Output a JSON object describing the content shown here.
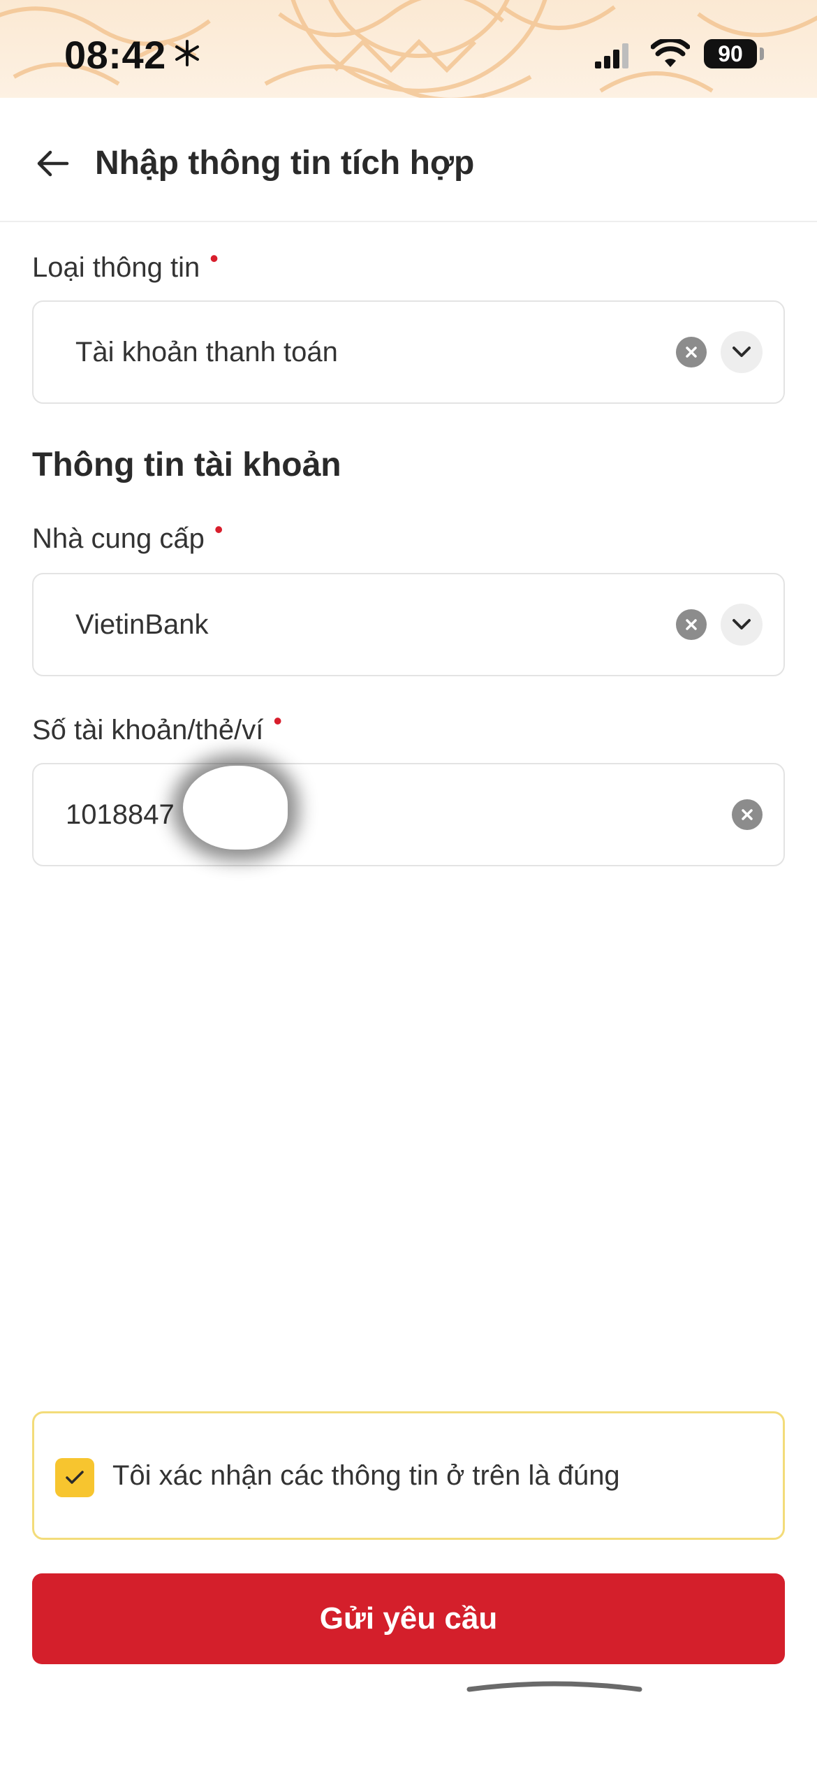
{
  "status_bar": {
    "time": "08:42",
    "battery": "90"
  },
  "header": {
    "title": "Nhập thông tin tích hợp"
  },
  "fields": {
    "info_type": {
      "label": "Loại thông tin",
      "required_mark": "•",
      "value": "Tài khoản thanh toán"
    },
    "section_title": "Thông tin tài khoản",
    "provider": {
      "label": "Nhà cung cấp",
      "required_mark": "•",
      "value": "VietinBank"
    },
    "account_number": {
      "label": "Số tài khoản/thẻ/ví",
      "required_mark": "•",
      "value": "1018847"
    }
  },
  "confirm": {
    "text": "Tôi xác nhận các thông tin ở trên là đúng",
    "checked": true
  },
  "submit": {
    "label": "Gửi yêu cầu"
  },
  "colors": {
    "primary": "#d41f2b",
    "checkbox": "#f7c52f",
    "confirm_border": "#f3dc7a",
    "required": "#d81e2c"
  },
  "icons": [
    "snowflake-icon",
    "signal-icon",
    "wifi-icon",
    "back-arrow-icon",
    "clear-icon",
    "chevron-down-icon",
    "check-icon"
  ]
}
